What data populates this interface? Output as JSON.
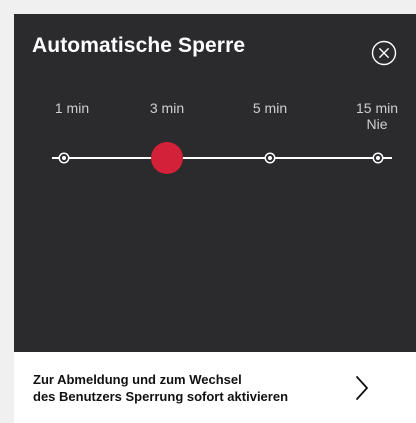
{
  "dialog": {
    "title": "Automatische Sperre",
    "close_icon": "close-circle-icon"
  },
  "slider": {
    "options": [
      "1 min",
      "3 min",
      "5 min",
      "15 min"
    ],
    "last_option_sublabel": "Nie",
    "selected_index": 1,
    "selected_value": "3 min",
    "accent_color": "#d3213a",
    "track_color": "#ffffff"
  },
  "footer": {
    "line1": "Zur Abmeldung und zum Wechsel",
    "line2": "des Benutzers Sperrung sofort aktivieren",
    "chevron_icon": "chevron-right-icon"
  },
  "colors": {
    "panel_background": "#2b2a2d",
    "page_background": "#f0f0f0"
  }
}
